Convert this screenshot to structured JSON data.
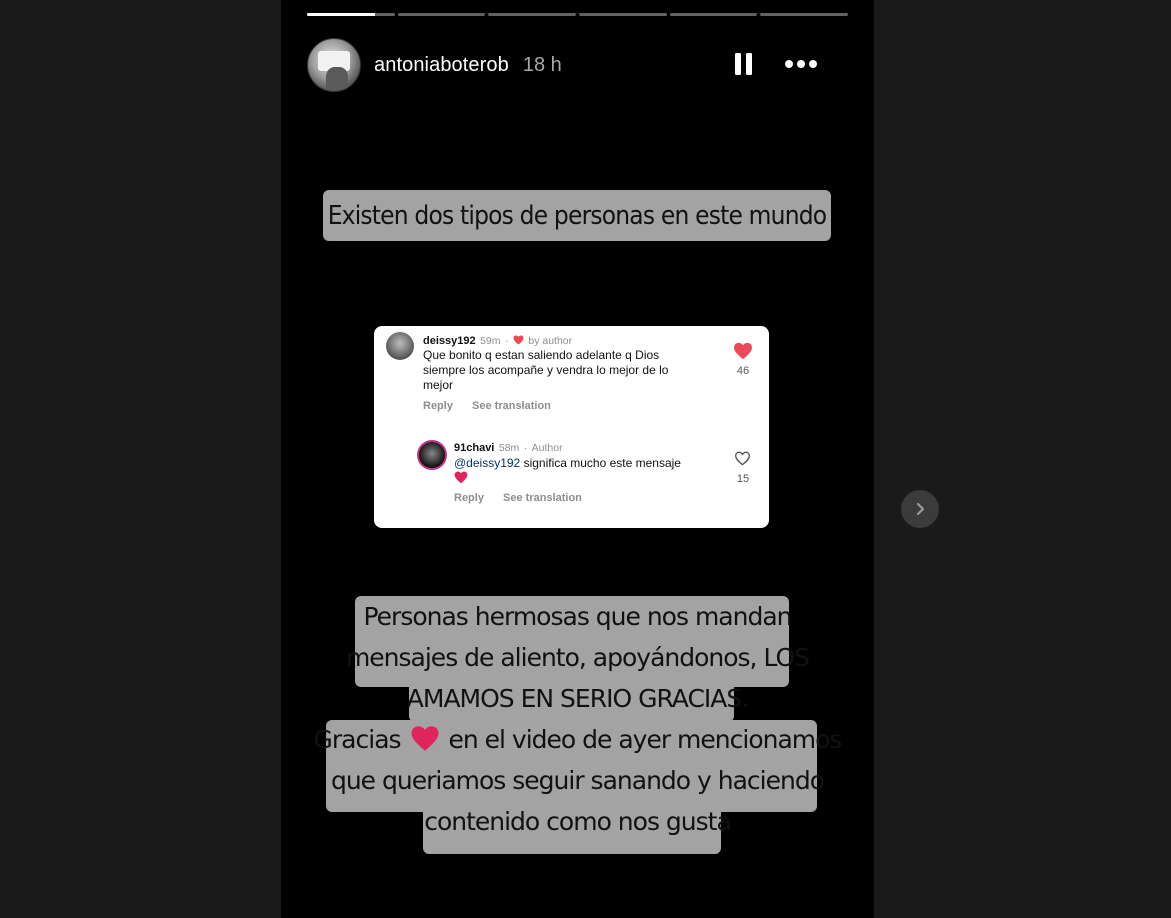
{
  "story": {
    "progress": [
      0.77,
      0,
      0,
      0,
      0,
      0
    ],
    "username": "antoniaboterob",
    "time_ago": "18 h",
    "caption_top": "Existen dos tipos de personas en este mundo",
    "caption_bottom_lines": [
      "Personas hermosas que nos mandan",
      "mensajes de aliento, apoyándonos, LOS",
      "AMAMOS EN SERIO GRACIAS.",
      "Gracias",
      "en el video de ayer mencionamos",
      "que queriamos seguir sanando y haciendo",
      "contenido como nos gusta"
    ]
  },
  "comment": {
    "user": "deissy192",
    "time": "59m",
    "liked_by": "by author",
    "text_lines": [
      "Que bonito q estan saliendo adelante q Dios",
      "siempre los acompañe y vendra lo mejor de lo",
      "mejor"
    ],
    "reply_label": "Reply",
    "translation_label": "See translation",
    "likes": "46"
  },
  "reply": {
    "user": "91chavi",
    "time": "58m",
    "role": "Author",
    "mention": "@deissy192",
    "text": "significa mucho este mensaje",
    "reply_label": "Reply",
    "translation_label": "See translation",
    "likes": "15"
  },
  "colors": {
    "page_bg": "#1a1a1a",
    "story_bg": "#000000",
    "caption_bg": "#a3a3a3",
    "heart_red": "#ed4956",
    "mention_blue": "#00376b"
  },
  "icons": {
    "pause": "pause-icon",
    "more": "more-horizontal-icon",
    "next": "chevron-right-icon",
    "heart": "heart-icon"
  }
}
